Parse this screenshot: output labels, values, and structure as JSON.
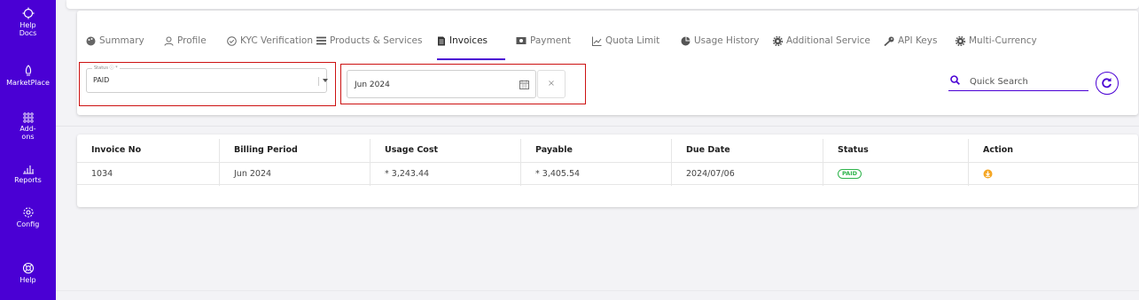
{
  "sidebar": {
    "items": [
      {
        "label1": "Help",
        "label2": "Docs",
        "icon": "help-docs-icon"
      },
      {
        "label1": "MarketPlace",
        "label2": "",
        "icon": "rocket-icon"
      },
      {
        "label1": "Add-",
        "label2": "ons",
        "icon": "addons-grid-icon"
      },
      {
        "label1": "Reports",
        "label2": "",
        "icon": "bar-chart-icon"
      },
      {
        "label1": "Config",
        "label2": "",
        "icon": "gear-icon"
      },
      {
        "label1": "Help",
        "label2": "",
        "icon": "lifebuoy-icon"
      }
    ]
  },
  "tabs": [
    {
      "label": "Summary",
      "icon": "palette-icon"
    },
    {
      "label": "Profile",
      "icon": "user-icon"
    },
    {
      "label": "KYC Verification",
      "icon": "check-circle-icon"
    },
    {
      "label": "Products & Services",
      "icon": "list-icon"
    },
    {
      "label": "Invoices",
      "icon": "document-icon"
    },
    {
      "label": "Payment",
      "icon": "money-icon"
    },
    {
      "label": "Quota Limit",
      "icon": "chart-line-icon"
    },
    {
      "label": "Usage History",
      "icon": "pie-icon"
    },
    {
      "label": "Additional Service",
      "icon": "cog-icon"
    },
    {
      "label": "API Keys",
      "icon": "key-icon"
    },
    {
      "label": "Multi-Currency",
      "icon": "cog-icon"
    }
  ],
  "active_tab": "Invoices",
  "filters": {
    "status_label": "Status ⓘ *",
    "status_value": "PAID",
    "date_value": "Jun 2024",
    "clear_label": "×",
    "search_placeholder": "Quick Search"
  },
  "table": {
    "columns": [
      "Invoice No",
      "Billing Period",
      "Usage Cost",
      "Payable",
      "Due Date",
      "Status",
      "Action"
    ],
    "rows": [
      {
        "invoice_no": "1034",
        "billing_period": "Jun 2024",
        "usage_cost": "* 3,243.44",
        "payable": "* 3,405.54",
        "due_date": "2024/07/06",
        "status": "PAID"
      }
    ]
  },
  "colors": {
    "brand": "#4a00d4",
    "highlight": "#cc1111",
    "paid": "#2db34a",
    "download": "#f5a623"
  }
}
